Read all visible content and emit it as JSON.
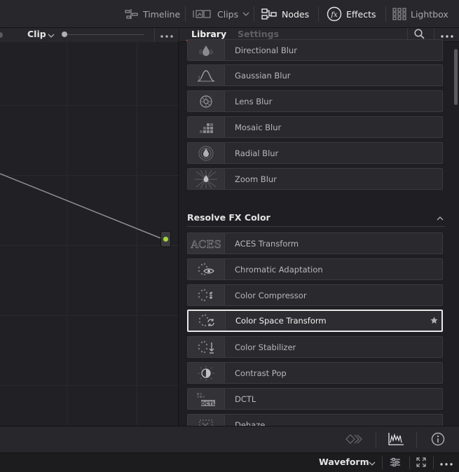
{
  "toolbar": {
    "items": [
      {
        "label": "Timeline",
        "icon": "timeline-icon",
        "active": false
      },
      {
        "label": "Clips",
        "icon": "clips-icon",
        "active": false
      },
      {
        "label": "Nodes",
        "icon": "nodes-icon",
        "active": true
      },
      {
        "label": "Effects",
        "icon": "fx-icon",
        "active": true
      },
      {
        "label": "Lightbox",
        "icon": "lightbox-icon",
        "active": false
      }
    ]
  },
  "node_editor": {
    "mode_label": "Clip"
  },
  "library": {
    "tabs": [
      {
        "label": "Library",
        "active": true
      },
      {
        "label": "Settings",
        "active": false
      }
    ],
    "blur_items": [
      {
        "label": "Directional Blur",
        "icon": "directional-blur-icon"
      },
      {
        "label": "Gaussian Blur",
        "icon": "gaussian-blur-icon"
      },
      {
        "label": "Lens Blur",
        "icon": "lens-blur-icon"
      },
      {
        "label": "Mosaic Blur",
        "icon": "mosaic-blur-icon"
      },
      {
        "label": "Radial Blur",
        "icon": "radial-blur-icon"
      },
      {
        "label": "Zoom Blur",
        "icon": "zoom-blur-icon"
      }
    ],
    "category": {
      "title": "Resolve FX Color",
      "items": [
        {
          "label": "ACES Transform",
          "icon": "aces-icon",
          "thumb_text": "ACES"
        },
        {
          "label": "Chromatic Adaptation",
          "icon": "chromatic-adaptation-icon"
        },
        {
          "label": "Color Compressor",
          "icon": "color-compressor-icon"
        },
        {
          "label": "Color Space Transform",
          "icon": "color-space-transform-icon",
          "selected": true
        },
        {
          "label": "Color Stabilizer",
          "icon": "color-stabilizer-icon"
        },
        {
          "label": "Contrast Pop",
          "icon": "contrast-pop-icon"
        },
        {
          "label": "DCTL",
          "icon": "dctl-icon",
          "thumb_text": "DCTL"
        },
        {
          "label": "Dehaze",
          "icon": "dehaze-icon"
        }
      ]
    }
  },
  "scopes": {
    "mode_label": "Waveform"
  },
  "colors": {
    "accent_red": "#d3442f",
    "node_output_green": "#a5d63b",
    "selected_border": "#e8e8e8"
  }
}
